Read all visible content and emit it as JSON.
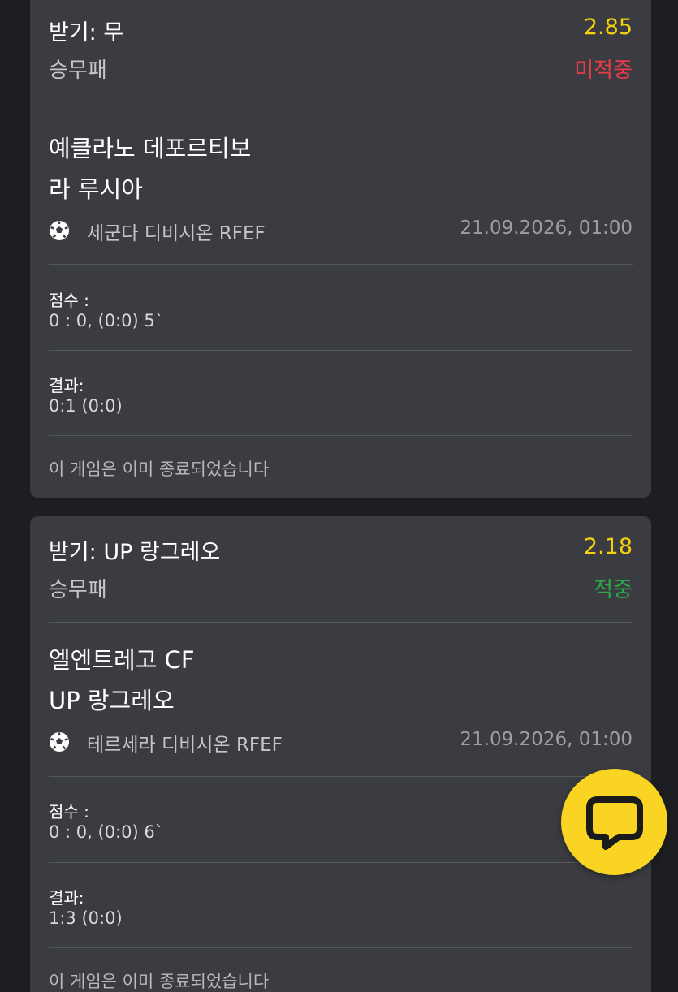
{
  "bets": [
    {
      "pick_label": "받기: 무",
      "odds": "2.85",
      "market": "승무패",
      "status": "미적중",
      "team_home": "예클라노 데포르티보",
      "team_away": "라 루시아",
      "league": "세군다 디비시온 RFEF",
      "date": "21.09.2026, 01:00",
      "score_label": "점수 :",
      "score_value": "0 : 0, (0:0) 5`",
      "result_label": "결과:",
      "result_value": "0:1 (0:0)",
      "footer": "이 게임은 이미 종료되었습니다"
    },
    {
      "pick_label": "받기: UP 랑그레오",
      "odds": "2.18",
      "market": "승무패",
      "status": "적중",
      "team_home": "엘엔트레고 CF",
      "team_away": "UP 랑그레오",
      "league": "테르세라 디비시온 RFEF",
      "date": "21.09.2026, 01:00",
      "score_label": "점수 :",
      "score_value": "0 : 0, (0:0) 6`",
      "result_label": "결과:",
      "result_value": "1:3 (0:0)",
      "footer": "이 게임은 이미 종료되었습니다"
    }
  ],
  "icons": {
    "sport": "soccer-ball-icon",
    "chat": "chat-bubble-icon"
  },
  "colors": {
    "background": "#1c1e22",
    "card": "#3a3c41",
    "odds": "#f7d10a",
    "lost": "#ea3a4a",
    "won": "#2da84a",
    "fab": "#f9d423"
  }
}
